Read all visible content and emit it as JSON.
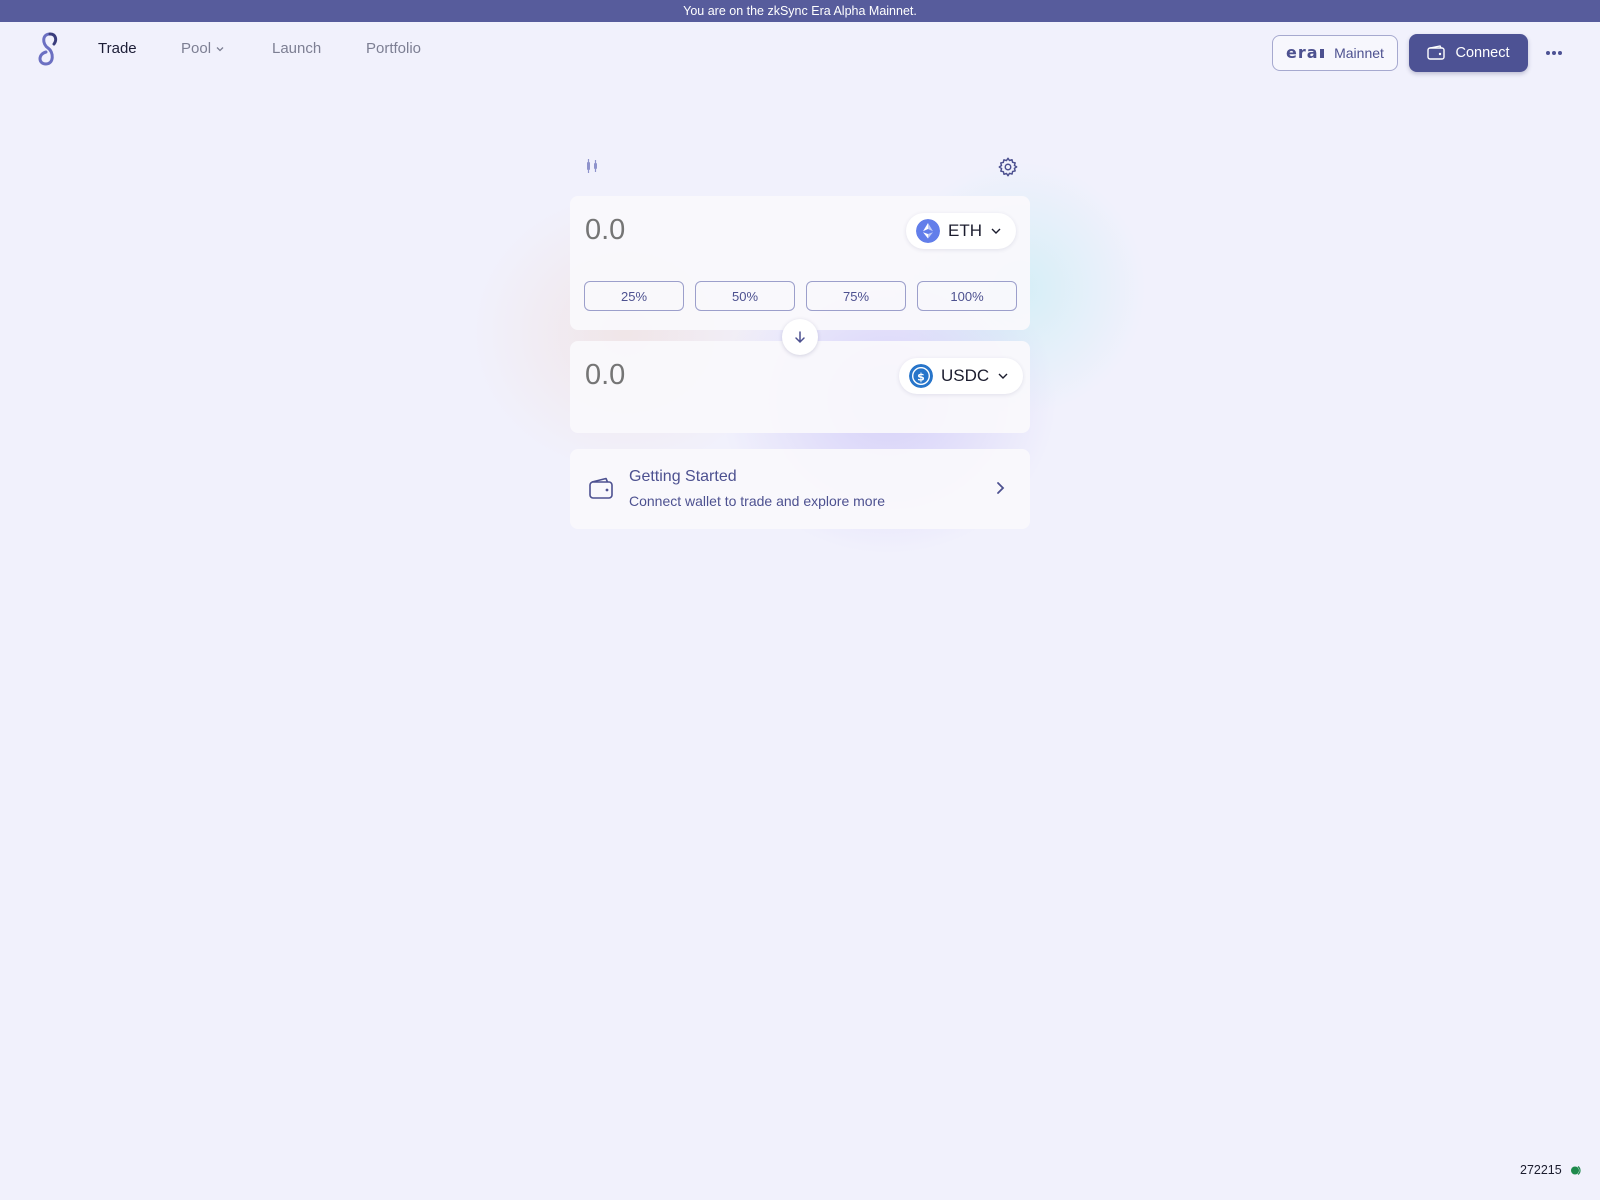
{
  "banner": {
    "text": "You are on the zkSync Era Alpha Mainnet."
  },
  "nav": {
    "items": [
      {
        "label": "Trade"
      },
      {
        "label": "Pool"
      },
      {
        "label": "Launch"
      },
      {
        "label": "Portfolio"
      }
    ],
    "active": "Trade"
  },
  "network": {
    "label": "Mainnet",
    "logo_text": "era"
  },
  "connect": {
    "label": "Connect"
  },
  "swap": {
    "from": {
      "amount_placeholder": "0.0",
      "token": "ETH"
    },
    "to": {
      "amount_placeholder": "0.0",
      "token": "USDC"
    },
    "percent_buttons": [
      "25%",
      "50%",
      "75%",
      "100%"
    ]
  },
  "getting_started": {
    "title": "Getting Started",
    "subtitle": "Connect wallet to trade and explore more"
  },
  "status": {
    "block_number": "272215",
    "dot_color": "#1e8a4c"
  },
  "colors": {
    "accent": "#4d5294",
    "banner": "#575c9c"
  }
}
